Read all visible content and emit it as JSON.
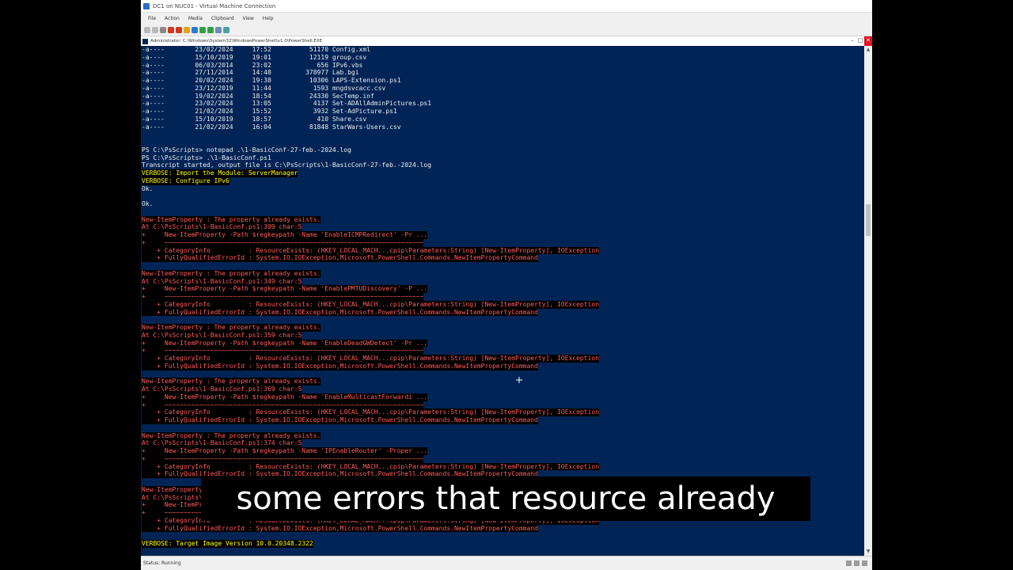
{
  "vm": {
    "title": "DC1 on NUC01 - Virtual Machine Connection",
    "menu": [
      "File",
      "Action",
      "Media",
      "Clipboard",
      "View",
      "Help"
    ],
    "status": "Status: Running"
  },
  "powershell": {
    "title": "Administrator: C:\\Windows\\System32\\WindowsPowerShell\\v1.0\\PowerShell.EXE"
  },
  "console_lines": [
    {
      "t": "-a----        23/02/2024     17:52          51170 Config.xml",
      "c": "default"
    },
    {
      "t": "-a----        15/10/2019     19:01          12119 group.csv",
      "c": "default"
    },
    {
      "t": "-a----        06/03/2014     23:02            656 IPv6.vbs",
      "c": "default"
    },
    {
      "t": "-a----        27/11/2014     14:48         378977 Lab.bgi",
      "c": "default"
    },
    {
      "t": "-a----        20/02/2024     19:38          10306 LAPS-Extension.ps1",
      "c": "default"
    },
    {
      "t": "-a----        23/12/2019     11:44           1593 mngdsvcacc.csv",
      "c": "default"
    },
    {
      "t": "-a----        19/02/2024     18:54          24330 SecTemp.inf",
      "c": "default"
    },
    {
      "t": "-a----        23/02/2024     13:05           4137 Set-ADAllAdminPictures.ps1",
      "c": "default"
    },
    {
      "t": "-a----        21/02/2024     15:52           3932 Set-AdPicture.ps1",
      "c": "default"
    },
    {
      "t": "-a----        15/10/2019     18:57            410 Share.csv",
      "c": "default"
    },
    {
      "t": "-a----        21/02/2024     16:04          81848 StarWars-Users.csv",
      "c": "default"
    },
    {
      "t": "",
      "c": "default"
    },
    {
      "t": "",
      "c": "default"
    },
    {
      "t": "PS C:\\PsScripts> notepad .\\1-BasicConf-27-feb.-2024.log",
      "c": "default"
    },
    {
      "t": "PS C:\\PsScripts> .\\1-BasicConf.ps1",
      "c": "default"
    },
    {
      "t": "Transcript started, output file is C:\\PsScripts\\1-BasicConf-27-feb.-2024.log",
      "c": "default"
    },
    {
      "t": "VERBOSE: Import the Module: ServerManager",
      "c": "verbose"
    },
    {
      "t": "VERBOSE: Configure IPv6",
      "c": "verbose"
    },
    {
      "t": "Ok.",
      "c": "default"
    },
    {
      "t": "",
      "c": "default"
    },
    {
      "t": "Ok.",
      "c": "default"
    },
    {
      "t": "",
      "c": "default"
    },
    {
      "t": "New-ItemProperty : The property already exists.",
      "c": "error"
    },
    {
      "t": "At C:\\PsScripts\\1-BasicConf.ps1:309 char:5",
      "c": "error"
    },
    {
      "t": "+     New-ItemProperty -Path $regkeypath -Name 'EnableICMPRedirect' -Pr ...",
      "c": "error"
    },
    {
      "t": "+     ~~~~~~~~~~~~~~~~~~~~~~~~~~~~~~~~~~~~~~~~~~~~~~~~~~~~~~~~~~~~~~~~~~~~",
      "c": "error"
    },
    {
      "t": "    + CategoryInfo          : ResourceExists: (HKEY_LOCAL_MACH...cpip\\Parameters:String) [New-ItemProperty], IOException",
      "c": "error"
    },
    {
      "t": "    + FullyQualifiedErrorId : System.IO.IOException,Microsoft.PowerShell.Commands.NewItemPropertyCommand",
      "c": "error"
    },
    {
      "t": "",
      "c": "sel"
    },
    {
      "t": "New-ItemProperty : The property already exists.",
      "c": "error"
    },
    {
      "t": "At C:\\PsScripts\\1-BasicConf.ps1:349 char:5",
      "c": "error"
    },
    {
      "t": "+     New-ItemProperty -Path $regkeypath -Name 'EnablePMTUDiscovery' -P ...",
      "c": "error"
    },
    {
      "t": "+     ~~~~~~~~~~~~~~~~~~~~~~~~~~~~~~~~~~~~~~~~~~~~~~~~~~~~~~~~~~~~~~~~~~~~",
      "c": "error"
    },
    {
      "t": "    + CategoryInfo          : ResourceExists: (HKEY_LOCAL_MACH...cpip\\Parameters:String) [New-ItemProperty], IOException",
      "c": "error"
    },
    {
      "t": "    + FullyQualifiedErrorId : System.IO.IOException,Microsoft.PowerShell.Commands.NewItemPropertyCommand",
      "c": "error"
    },
    {
      "t": "",
      "c": "sel"
    },
    {
      "t": "New-ItemProperty : The property already exists.",
      "c": "error"
    },
    {
      "t": "At C:\\PsScripts\\1-BasicConf.ps1:359 char:5",
      "c": "error"
    },
    {
      "t": "+     New-ItemProperty -Path $regkeypath -Name 'EnableDeadGWDetect' -Pr ...",
      "c": "error"
    },
    {
      "t": "+     ~~~~~~~~~~~~~~~~~~~~~~~~~~~~~~~~~~~~~~~~~~~~~~~~~~~~~~~~~~~~~~~~~~~~",
      "c": "error"
    },
    {
      "t": "    + CategoryInfo          : ResourceExists: (HKEY_LOCAL_MACH...cpip\\Parameters:String) [New-ItemProperty], IOException",
      "c": "error"
    },
    {
      "t": "    + FullyQualifiedErrorId : System.IO.IOException,Microsoft.PowerShell.Commands.NewItemPropertyCommand",
      "c": "error"
    },
    {
      "t": "",
      "c": "sel"
    },
    {
      "t": "New-ItemProperty : The property already exists.",
      "c": "error"
    },
    {
      "t": "At C:\\PsScripts\\1-BasicConf.ps1:369 char:5",
      "c": "error"
    },
    {
      "t": "+     New-ItemProperty -Path $regkeypath -Name 'EnableMulticastForwardi ...",
      "c": "error"
    },
    {
      "t": "+     ~~~~~~~~~~~~~~~~~~~~~~~~~~~~~~~~~~~~~~~~~~~~~~~~~~~~~~~~~~~~~~~~~~~~",
      "c": "error"
    },
    {
      "t": "    + CategoryInfo          : ResourceExists: (HKEY_LOCAL_MACH...cpip\\Parameters:String) [New-ItemProperty], IOException",
      "c": "error"
    },
    {
      "t": "    + FullyQualifiedErrorId : System.IO.IOException,Microsoft.PowerShell.Commands.NewItemPropertyCommand",
      "c": "error"
    },
    {
      "t": "",
      "c": "sel"
    },
    {
      "t": "New-ItemProperty : The property already exists.",
      "c": "error"
    },
    {
      "t": "At C:\\PsScripts\\1-BasicConf.ps1:374 char:5",
      "c": "error"
    },
    {
      "t": "+     New-ItemProperty -Path $regkeypath -Name 'IPEnableRouter' -Proper ...",
      "c": "error"
    },
    {
      "t": "+     ~~~~~~~~~~~~~~~~~~~~~~~~~~~~~~~~~~~~~~~~~~~~~~~~~~~~~~~~~~~~~~~~~~~~",
      "c": "error"
    },
    {
      "t": "    + CategoryInfo          : ResourceExists: (HKEY_LOCAL_MACH...cpip\\Parameters:String) [New-ItemProperty], IOException",
      "c": "error"
    },
    {
      "t": "    + FullyQualifiedErrorId : System.IO.IOException,Microsoft.PowerShell.Commands.NewItemPropertyCommand",
      "c": "error"
    },
    {
      "t": "",
      "c": "sel"
    },
    {
      "t": "New-ItemProperty : The property already exists.",
      "c": "error"
    },
    {
      "t": "At C:\\PsScripts\\1-BasicConf.ps1:379 char:5",
      "c": "error"
    },
    {
      "t": "+     New-ItemProperty ...",
      "c": "error"
    },
    {
      "t": "+     ~~~~~~~~~~~~~~~~~~~~~~~~~~~~~~~~~~~~~~~~~~~~~~~~~~~~~~~~~~~~~~~~~~~~",
      "c": "error"
    },
    {
      "t": "    + CategoryInfo          : ResourceExists: (HKEY_LOCAL_MACH...cpip\\Parameters:String) [New-ItemProperty], IOException",
      "c": "error"
    },
    {
      "t": "    + FullyQualifiedErrorId : System.IO.IOException,Microsoft.PowerShell.Commands.NewItemPropertyCommand",
      "c": "error"
    },
    {
      "t": "",
      "c": "default"
    },
    {
      "t": "VERBOSE: Target Image Version 10.0.20348.2322",
      "c": "verbose"
    }
  ],
  "caption": "some errors that resource already",
  "colors": {
    "console_bg": "#012456",
    "error_fg": "#ff5b5b",
    "verbose_fg": "#ffff00"
  }
}
